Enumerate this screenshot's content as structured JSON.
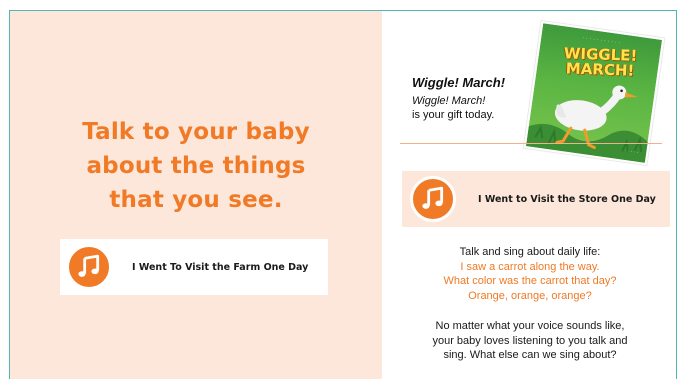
{
  "left": {
    "headline": [
      "Talk to your baby",
      "about the things",
      "that you see."
    ],
    "farm_song": {
      "title": "I Went To Visit the Farm One Day",
      "icon": "music-note-icon"
    }
  },
  "right": {
    "book": {
      "title": "Wiggle! March!",
      "subtitle_italic": "Wiggle! March!",
      "subtitle_plain": "is your gift today.",
      "cover_title_line1": "WIGGLE!",
      "cover_title_line2": "MARCH!"
    },
    "store_song": {
      "title": "I Went to Visit the Store One Day",
      "icon": "music-note-icon"
    },
    "talk": {
      "intro": "Talk and sing about daily life:",
      "lyrics": [
        "I saw a carrot along the way.",
        "What color was the carrot that day?",
        "Orange, orange, orange?"
      ]
    },
    "closing": [
      "No matter what your voice sounds like,",
      "your baby loves listening to you talk and",
      "sing. What else can we sing about?"
    ]
  },
  "colors": {
    "accent_orange": "#f07a26",
    "panel_peach": "#fde7da",
    "frame_teal": "#4fb8b4",
    "cover_green": "#4fa83d"
  }
}
